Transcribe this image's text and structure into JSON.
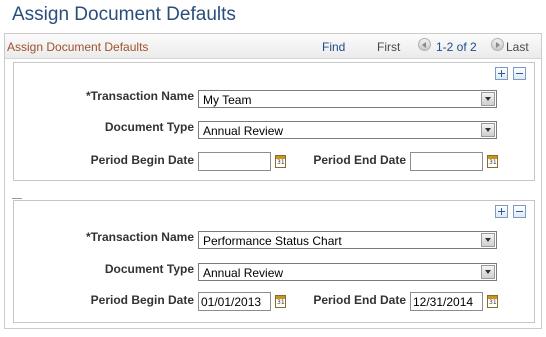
{
  "page": {
    "title": "Assign Document Defaults"
  },
  "grid": {
    "title": "Assign Document Defaults",
    "find": "Find",
    "first": "First",
    "count": "1-2 of 2",
    "last": "Last"
  },
  "labels": {
    "transaction_name": "*Transaction Name",
    "document_type": "Document Type",
    "period_begin_date": "Period Begin Date",
    "period_end_date": "Period End Date"
  },
  "rows": [
    {
      "transaction_name": "My Team",
      "document_type": "Annual Review",
      "period_begin_date": "",
      "period_end_date": ""
    },
    {
      "transaction_name": "Performance Status Chart",
      "document_type": "Annual Review",
      "period_begin_date": "01/01/2013",
      "period_end_date": "12/31/2014"
    }
  ],
  "icons": {
    "add": "plus-icon",
    "delete": "minus-icon",
    "calendar": "calendar-icon",
    "prev": "previous-arrow-icon",
    "next": "next-arrow-icon",
    "dropdown": "chevron-down-icon"
  },
  "colors": {
    "title": "#2a4e7c",
    "grid_title": "#a0512d",
    "link": "#214c8c"
  }
}
